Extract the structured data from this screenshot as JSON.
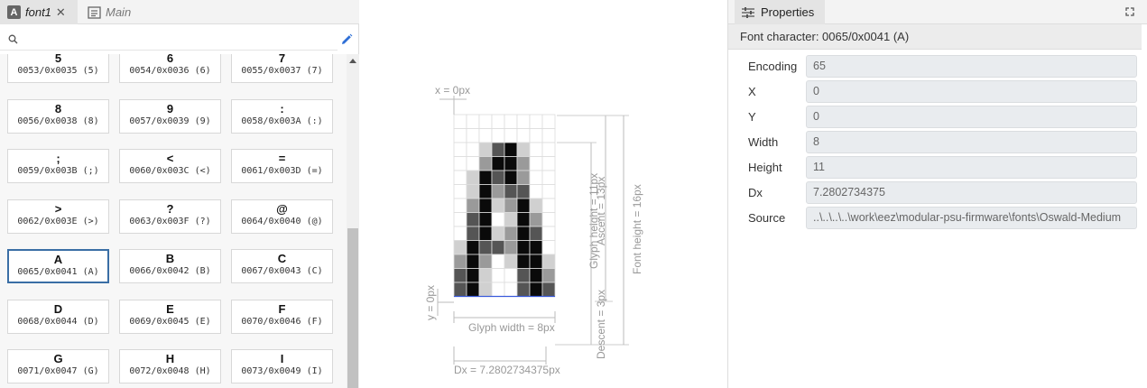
{
  "tabs": [
    {
      "label": "font1",
      "icon": "font-icon",
      "active": true
    },
    {
      "label": "Main",
      "icon": "document-icon",
      "active": false
    }
  ],
  "search": {
    "placeholder": "",
    "value": ""
  },
  "characters": [
    {
      "char": "5",
      "code": "0053/0x0035 (5)"
    },
    {
      "char": "6",
      "code": "0054/0x0036 (6)"
    },
    {
      "char": "7",
      "code": "0055/0x0037 (7)"
    },
    {
      "char": "8",
      "code": "0056/0x0038 (8)"
    },
    {
      "char": "9",
      "code": "0057/0x0039 (9)"
    },
    {
      "char": ":",
      "code": "0058/0x003A (:)"
    },
    {
      "char": ";",
      "code": "0059/0x003B (;)"
    },
    {
      "char": "<",
      "code": "0060/0x003C (<)"
    },
    {
      "char": "=",
      "code": "0061/0x003D (=)"
    },
    {
      "char": ">",
      "code": "0062/0x003E (>)"
    },
    {
      "char": "?",
      "code": "0063/0x003F (?)"
    },
    {
      "char": "@",
      "code": "0064/0x0040 (@)"
    },
    {
      "char": "A",
      "code": "0065/0x0041 (A)",
      "selected": true
    },
    {
      "char": "B",
      "code": "0066/0x0042 (B)"
    },
    {
      "char": "C",
      "code": "0067/0x0043 (C)"
    },
    {
      "char": "D",
      "code": "0068/0x0044 (D)"
    },
    {
      "char": "E",
      "code": "0069/0x0045 (E)"
    },
    {
      "char": "F",
      "code": "0070/0x0046 (F)"
    },
    {
      "char": "G",
      "code": "0071/0x0047 (G)"
    },
    {
      "char": "H",
      "code": "0072/0x0048 (H)"
    },
    {
      "char": "I",
      "code": "0073/0x0049 (I)"
    }
  ],
  "glyph_preview": {
    "x_label": "x = 0px",
    "y_label": "y = 0px",
    "glyph_width_label": "Glyph width = 8px",
    "glyph_height_label": "Glyph height = 11px",
    "ascent_label": "Ascent = 13px",
    "descent_label": "Descent = 3px",
    "font_height_label": "Font height = 16px",
    "dx_label": "Dx = 7.2802734375px",
    "pixels": [
      [
        0,
        0,
        0,
        0,
        0,
        0,
        0,
        0
      ],
      [
        0,
        0,
        0,
        0,
        0,
        0,
        0,
        0
      ],
      [
        0,
        0,
        1,
        3,
        4,
        1,
        0,
        0
      ],
      [
        0,
        0,
        2,
        4,
        4,
        2,
        0,
        0
      ],
      [
        0,
        1,
        4,
        3,
        4,
        2,
        0,
        0
      ],
      [
        0,
        1,
        4,
        2,
        3,
        3,
        0,
        0
      ],
      [
        0,
        2,
        4,
        1,
        2,
        4,
        1,
        0
      ],
      [
        0,
        3,
        4,
        0,
        1,
        4,
        2,
        0
      ],
      [
        0,
        3,
        4,
        1,
        2,
        4,
        3,
        0
      ],
      [
        1,
        4,
        3,
        3,
        2,
        4,
        4,
        0
      ],
      [
        2,
        4,
        2,
        0,
        1,
        4,
        4,
        1
      ],
      [
        3,
        4,
        1,
        0,
        0,
        3,
        4,
        2
      ],
      [
        3,
        4,
        1,
        0,
        0,
        3,
        4,
        3
      ]
    ]
  },
  "properties": {
    "tab_label": "Properties",
    "subheader": "Font character: 0065/0x0041 (A)",
    "rows": [
      {
        "label": "Encoding",
        "value": "65"
      },
      {
        "label": "X",
        "value": "0"
      },
      {
        "label": "Y",
        "value": "0"
      },
      {
        "label": "Width",
        "value": "8"
      },
      {
        "label": "Height",
        "value": "11"
      },
      {
        "label": "Dx",
        "value": "7.2802734375"
      },
      {
        "label": "Source",
        "value": "..\\..\\..\\..\\work\\eez\\modular-psu-firmware\\fonts\\Oswald-Medium"
      }
    ]
  },
  "colors": {
    "accent": "#3a6ea5",
    "baseline": "#3b5bdb"
  }
}
